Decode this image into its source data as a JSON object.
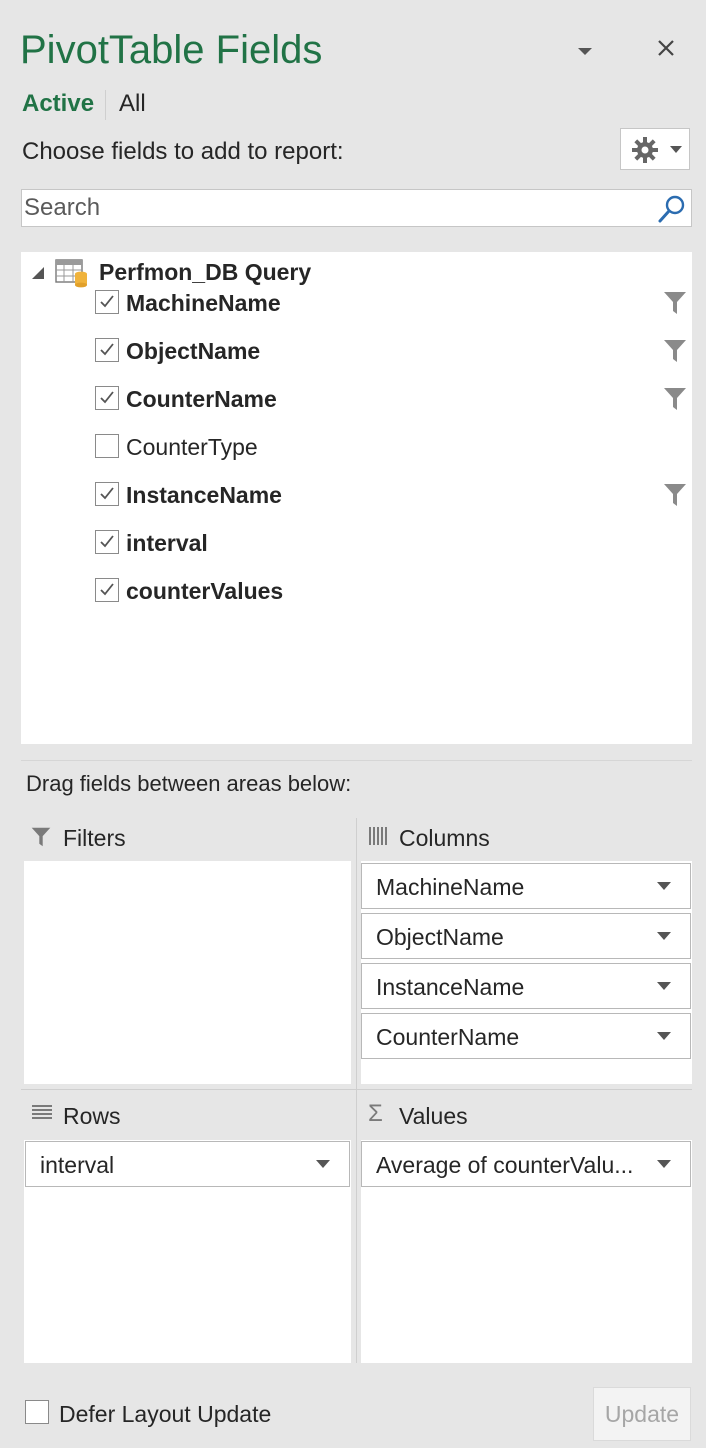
{
  "header": {
    "title": "PivotTable Fields",
    "dropdown_icon": "chevron-down-icon",
    "close_icon": "close-icon"
  },
  "tabs": [
    {
      "label": "Active",
      "selected": true
    },
    {
      "label": "All",
      "selected": false
    }
  ],
  "choose_label": "Choose fields to add to report:",
  "settings": {
    "icon": "gear-icon"
  },
  "search": {
    "placeholder": "Search",
    "value": ""
  },
  "field_list": {
    "table_name": "Perfmon_DB Query",
    "fields": [
      {
        "label": "MachineName",
        "checked": true,
        "filtered": true
      },
      {
        "label": "ObjectName",
        "checked": true,
        "filtered": true
      },
      {
        "label": "CounterName",
        "checked": true,
        "filtered": true
      },
      {
        "label": "CounterType",
        "checked": false,
        "filtered": false
      },
      {
        "label": "InstanceName",
        "checked": true,
        "filtered": true
      },
      {
        "label": "interval",
        "checked": true,
        "filtered": false
      },
      {
        "label": "counterValues",
        "checked": true,
        "filtered": false
      }
    ]
  },
  "areas": {
    "drag_label": "Drag fields between areas below:",
    "filters": {
      "label": "Filters",
      "items": []
    },
    "columns": {
      "label": "Columns",
      "items": [
        "MachineName",
        "ObjectName",
        "InstanceName",
        "CounterName"
      ]
    },
    "rows": {
      "label": "Rows",
      "items": [
        "interval"
      ]
    },
    "values": {
      "label": "Values",
      "items": [
        "Average of counterValu..."
      ]
    }
  },
  "footer": {
    "defer_label": "Defer Layout Update",
    "defer_checked": false,
    "update_label": "Update"
  },
  "colors": {
    "accent": "#217346",
    "background": "#e6e6e6",
    "panel": "#ffffff"
  }
}
